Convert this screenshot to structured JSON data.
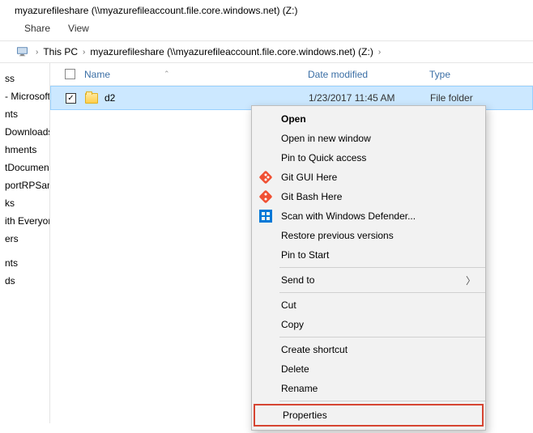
{
  "window": {
    "title": "myazurefileshare (\\\\myazurefileaccount.file.core.windows.net) (Z:)"
  },
  "ribbon": {
    "share": "Share",
    "view": "View"
  },
  "breadcrumbs": {
    "pc": "This PC",
    "loc": "myazurefileshare (\\\\myazurefileaccount.file.core.windows.net) (Z:)"
  },
  "sidebar": {
    "items": [
      "ss",
      "- Microsoft",
      "nts",
      "Downloads",
      "hments",
      "tDocumen",
      "portRPSam",
      "ks",
      "ith Everyon",
      "ers",
      "",
      "nts",
      "ds"
    ]
  },
  "columns": {
    "name": "Name",
    "date": "Date modified",
    "type": "Type"
  },
  "rows": [
    {
      "name": "d2",
      "date": "1/23/2017 11:45 AM",
      "type": "File folder"
    }
  ],
  "context_menu": {
    "open": "Open",
    "open_new": "Open in new window",
    "pin_qa": "Pin to Quick access",
    "git_gui": "Git GUI Here",
    "git_bash": "Git Bash Here",
    "defender": "Scan with Windows Defender...",
    "restore": "Restore previous versions",
    "pin_start": "Pin to Start",
    "send_to": "Send to",
    "cut": "Cut",
    "copy": "Copy",
    "shortcut": "Create shortcut",
    "delete": "Delete",
    "rename": "Rename",
    "properties": "Properties"
  }
}
